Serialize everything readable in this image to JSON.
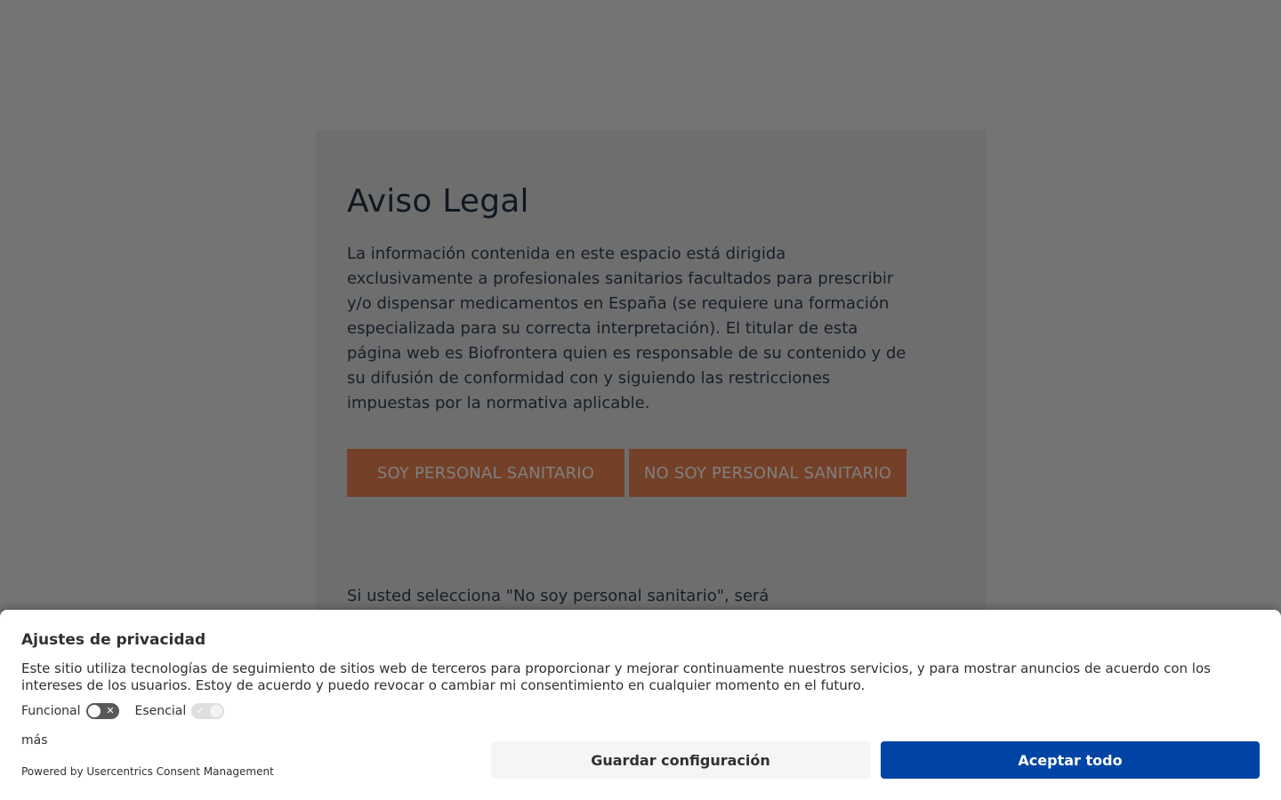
{
  "legal": {
    "title": "Aviso Legal",
    "body": "La información contenida en este espacio está dirigida exclusivamente a profesionales sanitarios facultados para prescribir y/o dispensar medicamentos en España (se requiere una formación especializada para su correcta interpretación). El titular de esta página web es Biofrontera quien es responsable de su contenido y de su difusión de conformidad con y siguiendo las restricciones impuestas por la normativa aplicable.",
    "yes_button": "SOY PERSONAL SANITARIO",
    "no_button": "NO SOY PERSONAL SANITARIO",
    "footnote": "Si usted selecciona \"No soy personal sanitario\", será"
  },
  "consent": {
    "title": "Ajustes de privacidad",
    "description": "Este sitio utiliza tecnologías de seguimiento de sitios web de terceros para proporcionar y mejorar continuamente nuestros servicios, y para mostrar anuncios de acuerdo con los intereses de los usuarios. Estoy de acuerdo y puedo revocar o cambiar mi consentimiento en cualquier momento en el futuro.",
    "toggles": [
      {
        "label": "Funcional",
        "state": "off",
        "icon": "close-icon",
        "glyph": "✕"
      },
      {
        "label": "Esencial",
        "state": "on-disabled",
        "icon": "check-icon",
        "glyph": "✓"
      }
    ],
    "more_link": "más",
    "powered_by": "Powered by Usercentrics Consent Management",
    "save_button": "Guardar configuración",
    "accept_button": "Aceptar todo"
  },
  "colors": {
    "accent_orange": "#e8804f",
    "accept_blue": "#0045a5",
    "title_navy": "#1f3144"
  }
}
